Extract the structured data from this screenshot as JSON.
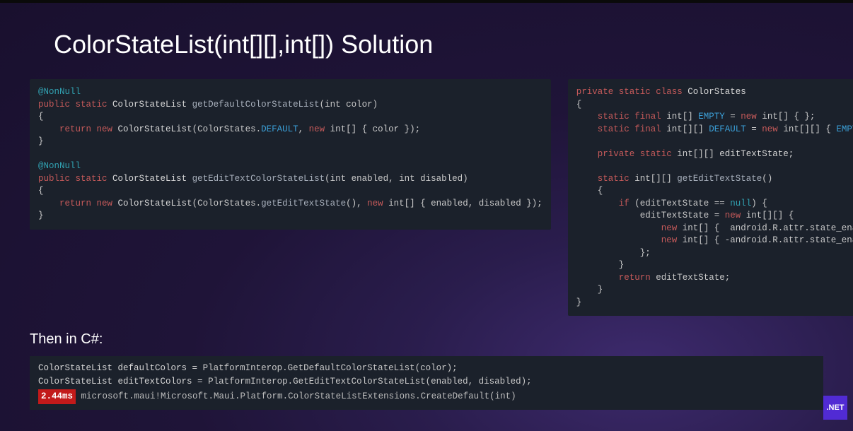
{
  "title": "ColorStateList(int[][],int[]) Solution",
  "subheading": "Then in C#:",
  "java_left": {
    "a1": "@NonNull",
    "l2": {
      "kw1": "public static",
      "type": "ColorStateList",
      "fn": "getDefaultColorStateList",
      "params": "(int color)"
    },
    "l3": "{",
    "l4": {
      "ret": "return new",
      "type": "ColorStateList",
      "args_open": "(ColorStates.",
      "const": "DEFAULT",
      "mid": ", ",
      "kw_new": "new",
      "tail": " int[] { color });"
    },
    "l5": "}",
    "a2": "@NonNull",
    "l7": {
      "kw1": "public static",
      "type": "ColorStateList",
      "fn": "getEditTextColorStateList",
      "params": "(int enabled, int disabled)"
    },
    "l8": "{",
    "l9": {
      "ret": "return new",
      "type": "ColorStateList",
      "args_open": "(ColorStates.",
      "fn2": "getEditTextState",
      "mid": "(), ",
      "kw_new": "new",
      "tail": " int[] { enabled, disabled });"
    },
    "l10": "}"
  },
  "java_right": {
    "r1": {
      "kw": "private static class",
      "name": "ColorStates"
    },
    "r2": "{",
    "r3": {
      "kw": "static final",
      "type": " int[] ",
      "name": "EMPTY",
      "eq": " = ",
      "kw2": "new",
      "tail": " int[] { };"
    },
    "r4": {
      "kw": "static final",
      "type": " int[][] ",
      "name": "DEFAULT",
      "eq": " = ",
      "kw2": "new",
      "tail": " int[][] { ",
      "ref": "EMPTY",
      "end": " };"
    },
    "r5": {
      "kw": "private static",
      "type": " int[][] ",
      "name": "editTextState;"
    },
    "r6": {
      "kw": "static",
      "type": " int[][] ",
      "fn": "getEditTextState",
      "tail": "()"
    },
    "r7": "    {",
    "r8": {
      "kw": "if",
      "cond": " (editTextState == ",
      "null": "null",
      "end": ") {"
    },
    "r9": {
      "lhs": "            editTextState = ",
      "kw": "new",
      "tail": " int[][] {"
    },
    "r10": {
      "kw": "new",
      "tail": " int[] {  android.R.attr.state_enabled },"
    },
    "r11": {
      "kw": "new",
      "tail": " int[] { -android.R.attr.state_enabled },"
    },
    "r12": "            };",
    "r13": "        }",
    "r14": {
      "kw": "return",
      "tail": " editTextState;"
    },
    "r15": "    }",
    "r16": "}"
  },
  "csharp": {
    "c1": {
      "type": "ColorStateList",
      "var": " defaultColors = ",
      "call": "PlatformInterop.GetDefaultColorStateList(color);"
    },
    "c2": {
      "type": "ColorStateList",
      "var": " editTextColors = ",
      "call": "PlatformInterop.GetEditTextColorStateList(enabled, disabled);"
    }
  },
  "timing": {
    "value": "2.44ms",
    "label": " microsoft.maui!Microsoft.Maui.Platform.ColorStateListExtensions.CreateDefault(int)"
  },
  "badge": ".NET"
}
